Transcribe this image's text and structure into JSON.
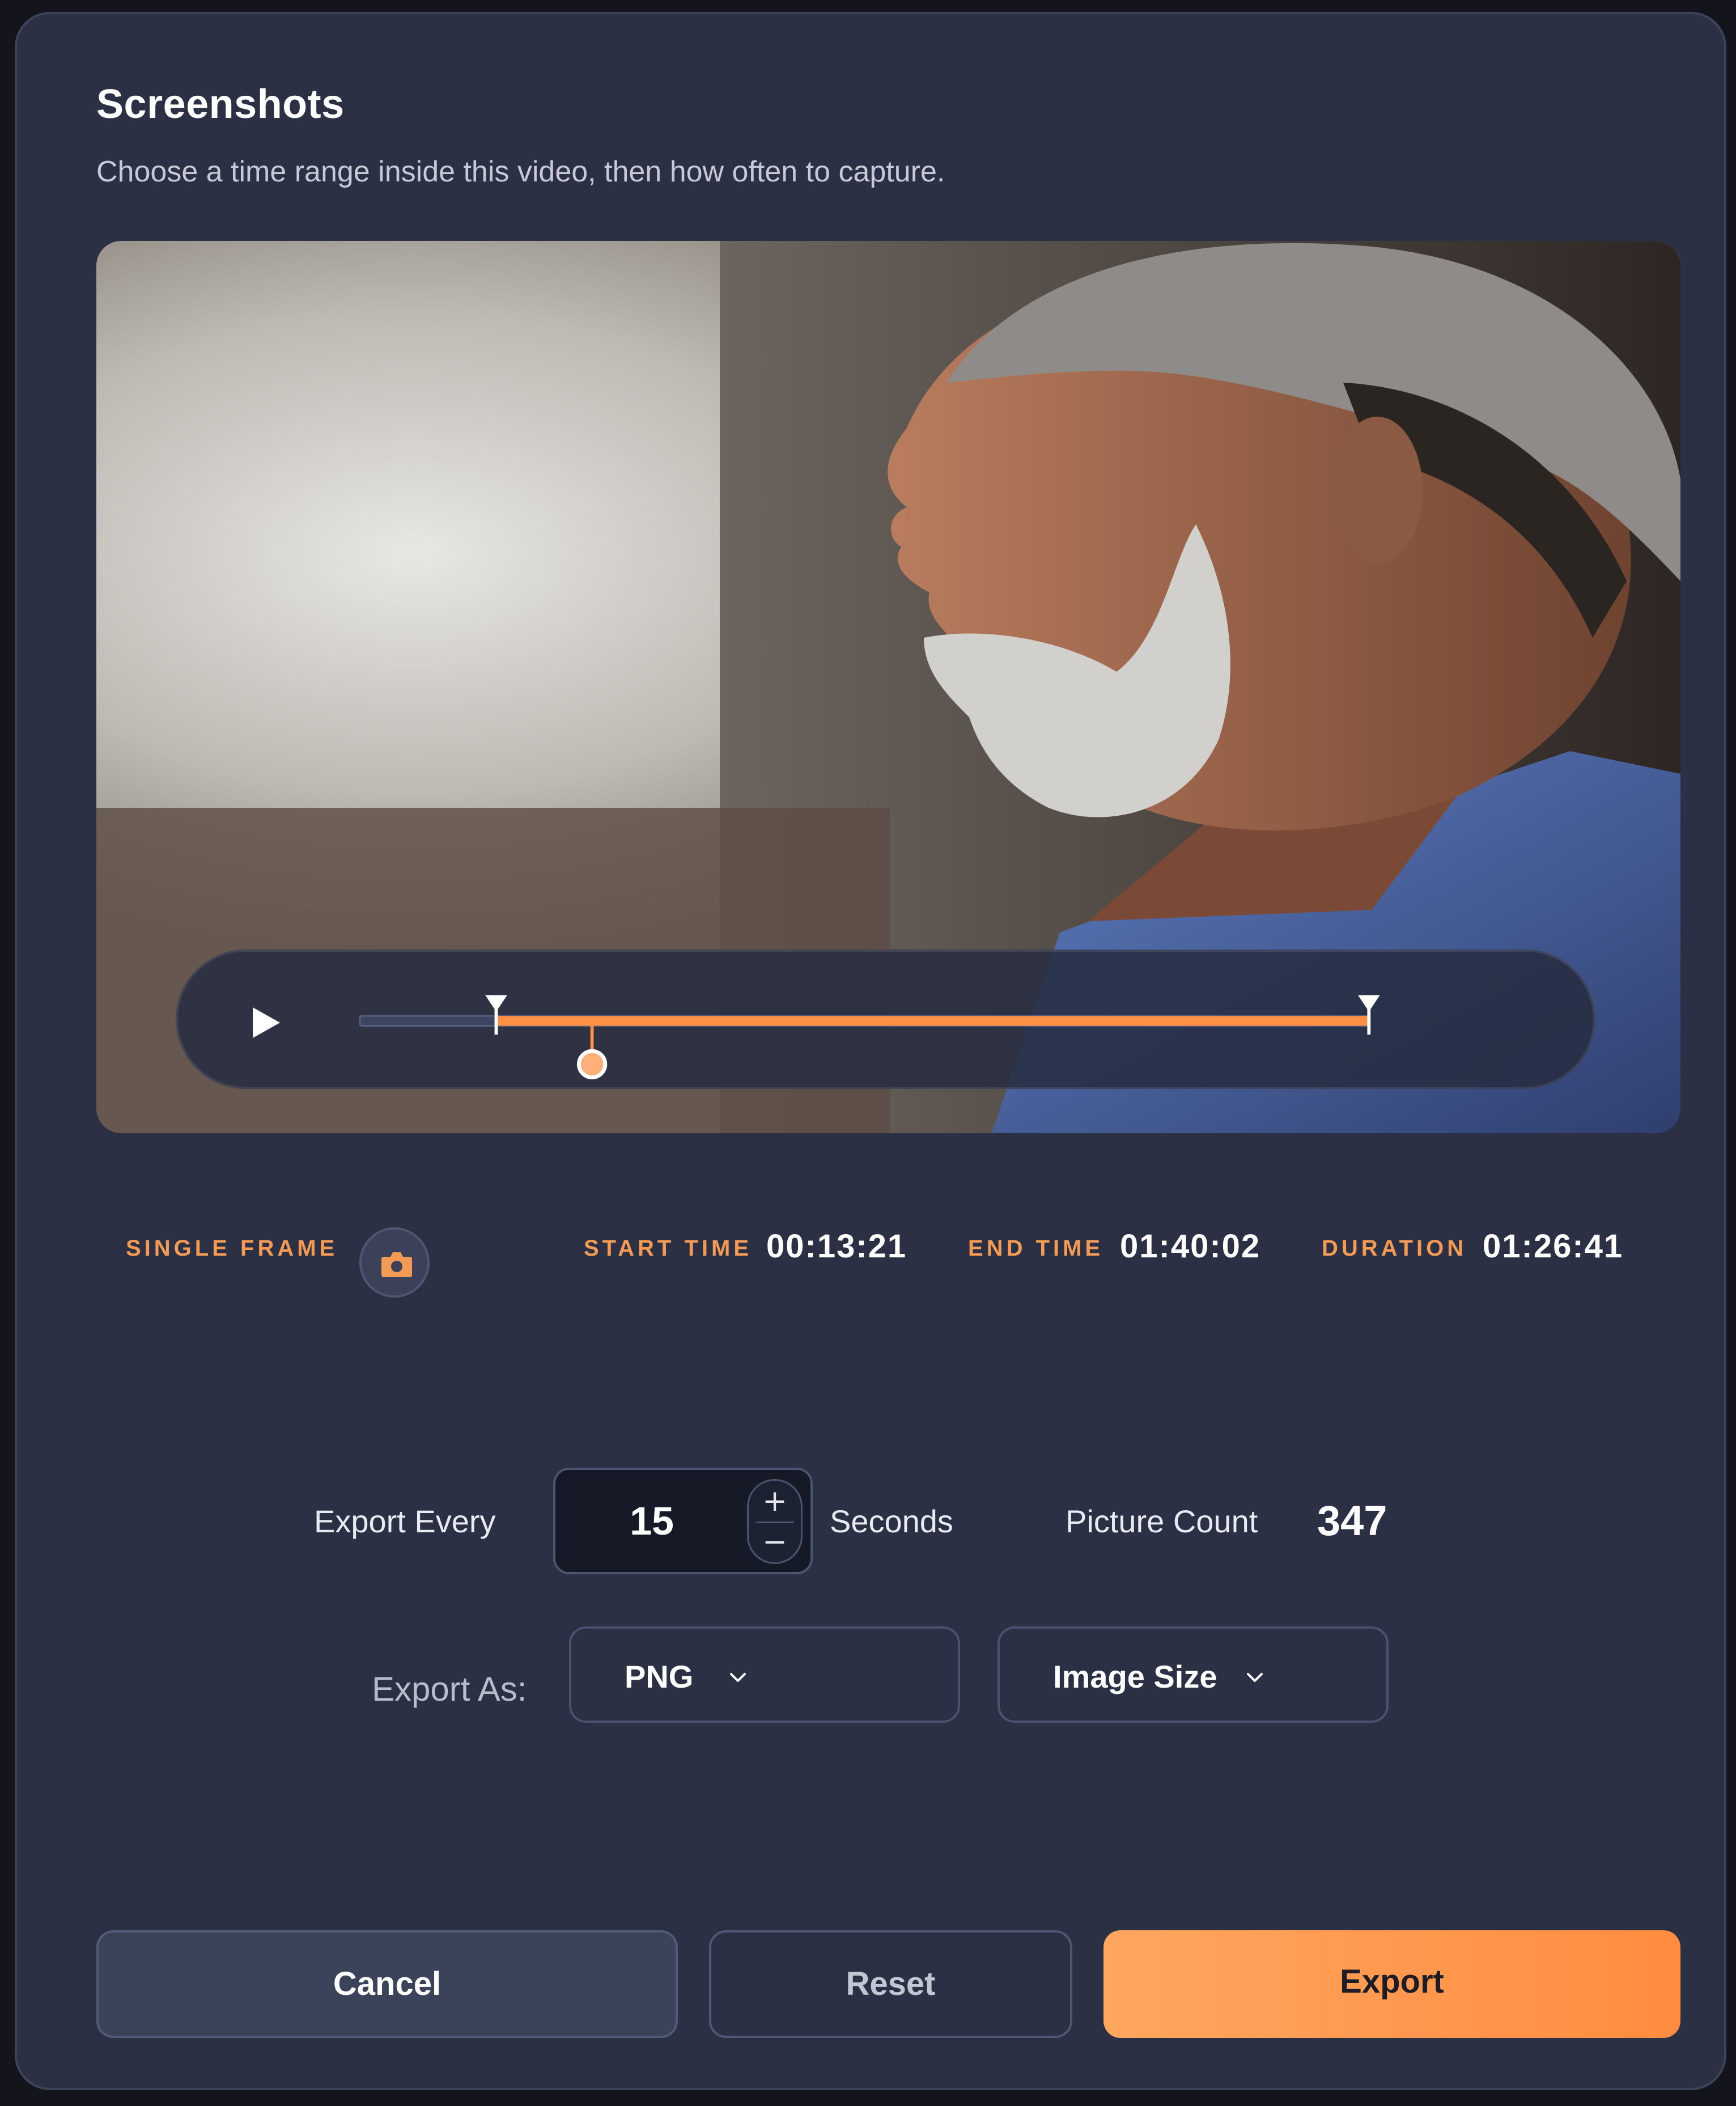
{
  "dialog": {
    "title": "Screenshots",
    "subtitle": "Choose a time range inside this video, then how often to capture."
  },
  "player": {
    "play_icon": "play-icon",
    "range_start_fraction": 0.135,
    "range_end_fraction": 1.0,
    "playhead_fraction": 0.23,
    "accent_color": "#ff8f45"
  },
  "info": {
    "single_frame_label": "SINGLE FRAME",
    "snapshot_icon": "camera-icon",
    "start_label": "START TIME",
    "start_value": "00:13:21",
    "end_label": "END TIME",
    "end_value": "01:40:02",
    "duration_label": "DURATION",
    "duration_value": "01:26:41"
  },
  "export_every": {
    "label": "Export Every",
    "value": "15",
    "plus": "+",
    "minus": "−",
    "unit": "Seconds"
  },
  "picture_count": {
    "label": "Picture Count",
    "value": "347"
  },
  "export_as": {
    "label": "Export As:",
    "format": "PNG",
    "size": "Image Size"
  },
  "buttons": {
    "cancel": "Cancel",
    "reset": "Reset",
    "export": "Export"
  },
  "colors": {
    "accent": "#ff8f45",
    "label_orange": "#f39a55",
    "panel": "#2b3044"
  }
}
